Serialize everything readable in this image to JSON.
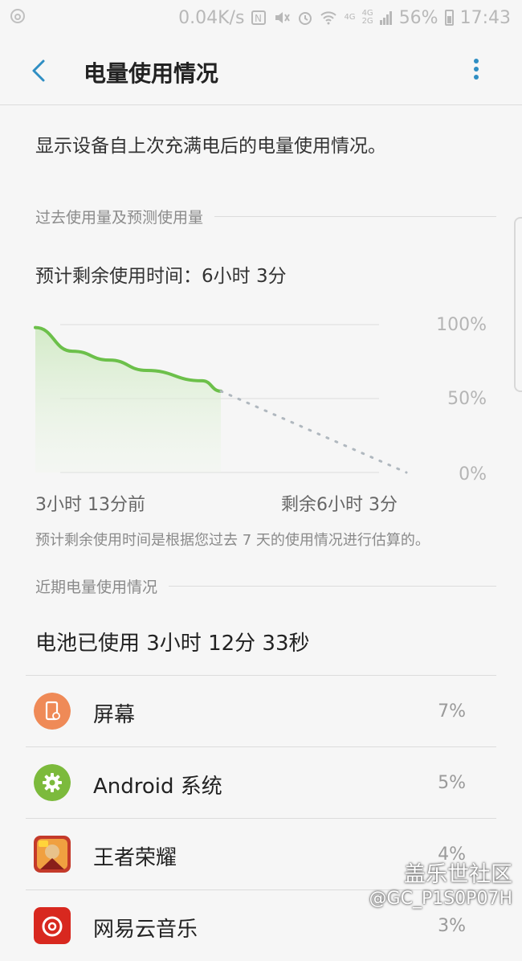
{
  "status_bar": {
    "speed": "0.04K/s",
    "network_top": "4G",
    "network_bottom": "4G",
    "network_2g": "2G",
    "battery": "56%",
    "time": "17:43",
    "icons": [
      "netease-icon",
      "nfc-icon",
      "mute-icon",
      "alarm-icon",
      "wifi-icon",
      "signal-icon",
      "battery-icon"
    ]
  },
  "header": {
    "title": "电量使用情况"
  },
  "description": "显示设备自上次充满电后的电量使用情况。",
  "past_section": {
    "heading": "过去使用量及预测使用量",
    "estimate": "预计剩余使用时间：6小时 3分",
    "note": "预计剩余使用时间是根据您过去 7 天的使用情况进行估算的。"
  },
  "chart_data": {
    "type": "line",
    "y_ticks": [
      "100%",
      "50%",
      "0%"
    ],
    "ylim": [
      0,
      100
    ],
    "x_labels": [
      "3小时 13分前",
      "剩余6小时 3分"
    ],
    "series": [
      {
        "style": "solid",
        "color": "#6cc04a",
        "x_frac": [
          0,
          0.1,
          0.2,
          0.3,
          0.45,
          0.5
        ],
        "values": [
          98,
          82,
          76,
          69,
          62,
          55
        ]
      },
      {
        "style": "dotted",
        "color": "#b0b8bf",
        "x_frac": [
          0.5,
          1.0
        ],
        "values": [
          55,
          0
        ]
      }
    ]
  },
  "recent_section": {
    "heading": "近期电量使用情况",
    "used": "电池已使用 3小时 12分 33秒",
    "apps": [
      {
        "name": "屏幕",
        "percent": "7%",
        "icon": "screen-icon",
        "color": "#ef8a57"
      },
      {
        "name": "Android 系统",
        "percent": "5%",
        "icon": "gear-icon",
        "color": "#7cba3c"
      },
      {
        "name": "王者荣耀",
        "percent": "4%",
        "icon": "game-icon",
        "color": "#c43a2a"
      },
      {
        "name": "网易云音乐",
        "percent": "3%",
        "icon": "music-icon",
        "color": "#d8281f"
      }
    ]
  },
  "watermark": {
    "line1": "盖乐世社区",
    "line2": "@GC_P1S0P07H"
  }
}
